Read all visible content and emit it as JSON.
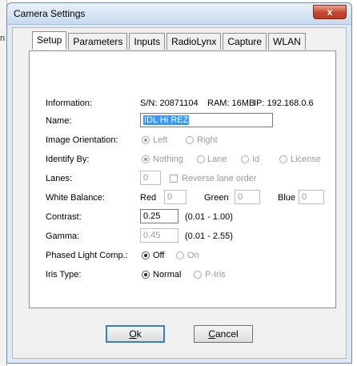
{
  "window": {
    "title": "Camera Settings",
    "close_glyph": "x"
  },
  "behind": {
    "mark": "n"
  },
  "tabs": [
    {
      "label": "Setup",
      "active": true
    },
    {
      "label": "Parameters"
    },
    {
      "label": "Inputs"
    },
    {
      "label": "RadioLynx"
    },
    {
      "label": "Capture"
    },
    {
      "label": "WLAN"
    }
  ],
  "setup": {
    "information": {
      "label": "Information:",
      "sn": "S/N: 20871104",
      "ram": "RAM: 16MB",
      "ip": "IP: 192.168.0.6"
    },
    "name": {
      "label": "Name:",
      "value": "IDL Hi REZ"
    },
    "orientation": {
      "label": "Image Orientation:",
      "options": [
        "Left",
        "Right"
      ],
      "selected": "Left"
    },
    "identify": {
      "label": "Identify By:",
      "options": [
        "Nothing",
        "Lane",
        "Id",
        "License"
      ],
      "selected": "Nothing"
    },
    "lanes": {
      "label": "Lanes:",
      "value": "0",
      "reverse_label": "Reverse lane order"
    },
    "white_balance": {
      "label": "White Balance:",
      "red_label": "Red",
      "red": "0",
      "green_label": "Green",
      "green": "0",
      "blue_label": "Blue",
      "blue": "0"
    },
    "contrast": {
      "label": "Contrast:",
      "value": "0.25",
      "range": "(0.01 - 1.00)"
    },
    "gamma": {
      "label": "Gamma:",
      "value": "0.45",
      "range": "(0.01 - 2.55)"
    },
    "phased": {
      "label": "Phased Light Comp.:",
      "options": [
        "Off",
        "On"
      ],
      "selected": "Off"
    },
    "iris": {
      "label": "Iris Type:",
      "options": [
        "Normal",
        "P-Iris"
      ],
      "selected": "Normal"
    }
  },
  "buttons": {
    "ok_rest": "k",
    "ok_mnemonic": "O",
    "cancel_rest": "ancel",
    "cancel_mnemonic": "C"
  }
}
